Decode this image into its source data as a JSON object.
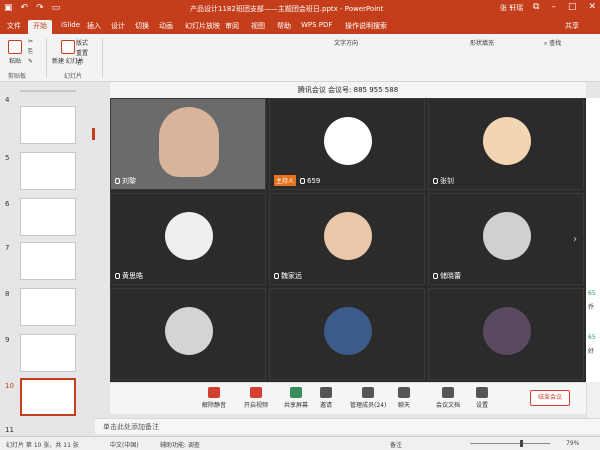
{
  "titlebar": {
    "doc_title": "产品设计1182班团支部——主题团会班日.pptx - PowerPoint",
    "user": "张 轩瑶"
  },
  "tabs": [
    "文件",
    "开始",
    "iSlide",
    "插入",
    "设计",
    "切换",
    "动画",
    "幻灯片放映",
    "审阅",
    "视图",
    "帮助",
    "WPS PDF",
    "操作说明搜索"
  ],
  "tab_active": "开始",
  "share": "共享",
  "ribbon": {
    "paste": "粘贴",
    "clipboard": "剪贴板",
    "new_slide": "新建\n幻灯片",
    "layout": "版式",
    "reset": "重置",
    "section": "节",
    "slides_group": "幻灯片",
    "find": "查找",
    "text_direction": "文字方向",
    "arrange": "排列",
    "shape_fill": "形状填充"
  },
  "meeting": {
    "banner": "腾讯会议  会议号: 885 955 588",
    "participants": [
      {
        "name": "刘黎",
        "host": false
      },
      {
        "name": "659",
        "host": true,
        "host_label": "主持人"
      },
      {
        "name": "张钊",
        "host": false
      },
      {
        "name": "黄思皓",
        "host": false
      },
      {
        "name": "魏家远",
        "host": false
      },
      {
        "name": "储晓蕾",
        "host": false
      },
      {
        "name": "",
        "host": false
      },
      {
        "name": "",
        "host": false
      },
      {
        "name": "",
        "host": false
      }
    ],
    "controls": [
      "解除静音",
      "开启视频",
      "共享屏幕",
      "邀请",
      "管理成员(24)",
      "聊天",
      "会议文档",
      "设置"
    ],
    "end_button": "结束会议",
    "chat_snips": [
      "65",
      "乔",
      "65",
      "好"
    ]
  },
  "slides": [
    "4",
    "5",
    "6",
    "7",
    "8",
    "9",
    "10",
    "11"
  ],
  "selected_slide": "10",
  "notes_placeholder": "单击此处添加备注",
  "status": {
    "slide_info": "幻灯片 第 10 张，共 11 张",
    "language": "中文(中国)",
    "accessibility": "辅助功能: 调查",
    "notes": "备注",
    "zoom": "79%"
  },
  "colors": {
    "accent": "#c43e1c",
    "meeting_bg": "#2b2b2b",
    "host_badge": "#e8731e"
  }
}
